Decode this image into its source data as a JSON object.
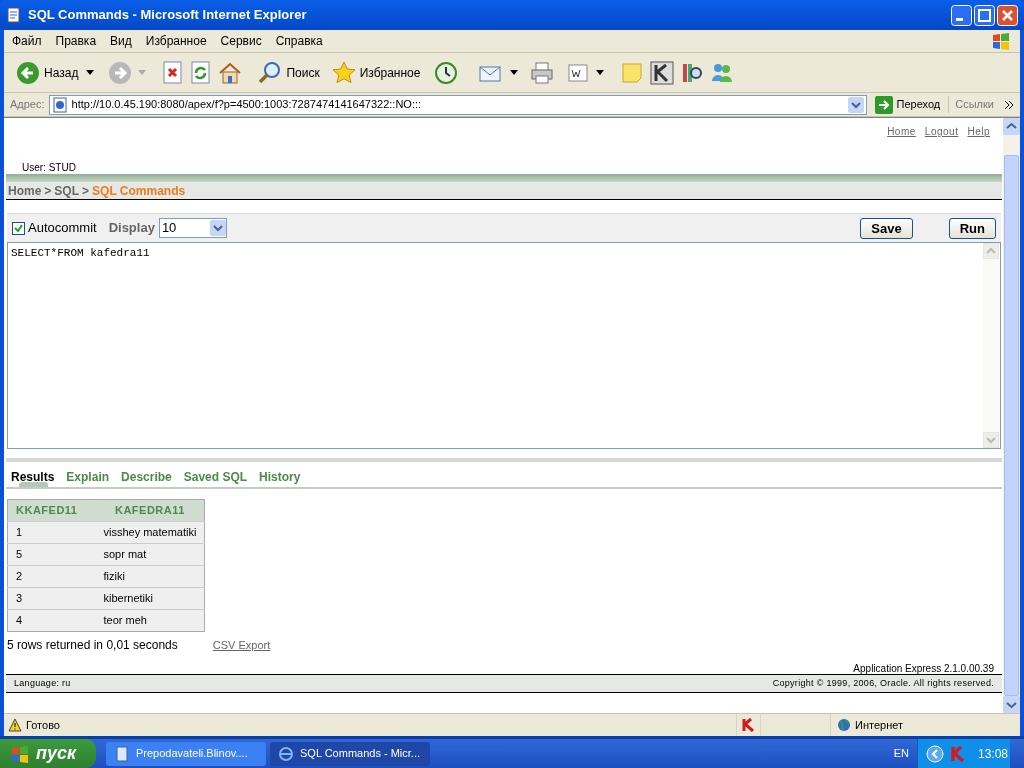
{
  "window": {
    "title": "SQL Commands - Microsoft Internet Explorer"
  },
  "menu": [
    "Файл",
    "Правка",
    "Вид",
    "Избранное",
    "Сервис",
    "Справка"
  ],
  "toolbar": {
    "back": "Назад",
    "search": "Поиск",
    "favorites": "Избранное"
  },
  "address": {
    "label": "Адрес:",
    "url": "http://10.0.45.190:8080/apex/f?p=4500:1003:7287474141647322::NO:::",
    "go": "Переход",
    "links": "Ссылки"
  },
  "page": {
    "header_links": [
      "Home",
      "Logout",
      "Help"
    ],
    "user": "User: STUD",
    "breadcrumb": [
      {
        "label": "Home",
        "current": false
      },
      {
        "separator": ">",
        "label": "SQL",
        "current": false
      },
      {
        "separator": ">",
        "label": "SQL Commands",
        "current": true
      }
    ],
    "autocommit": {
      "label": "Autocommit",
      "checked": true
    },
    "display": {
      "label": "Display",
      "value": "10"
    },
    "buttons": [
      "Save",
      "Run"
    ],
    "sql": "SELECT*FROM kafedra11",
    "tabs": [
      {
        "label": "Results",
        "selected": true
      },
      {
        "label": "Explain",
        "selected": false
      },
      {
        "label": "Describe",
        "selected": false
      },
      {
        "label": "Saved SQL",
        "selected": false
      },
      {
        "label": "History",
        "selected": false
      }
    ],
    "table": {
      "columns": [
        "KKAFED11",
        "KAFEDRA11"
      ],
      "rows": [
        [
          "1",
          "visshey matematiki"
        ],
        [
          "5",
          "sopr mat"
        ],
        [
          "2",
          "fiziki"
        ],
        [
          "3",
          "kibernetiki"
        ],
        [
          "4",
          "teor meh"
        ]
      ]
    },
    "summary": "5 rows returned in 0,01 seconds",
    "csv_export": "CSV Export",
    "version": "Application Express 2.1.0.00.39",
    "language": "Language: ru",
    "copyright": "Copyright © 1999, 2006, Oracle. All rights reserved."
  },
  "status_bar": {
    "text": "Готово",
    "zone": "Интернет"
  },
  "taskbar": {
    "start": "пуск",
    "tasks": [
      {
        "label": "Prepodavateli.Blinov....",
        "selected": false
      },
      {
        "label": "SQL Commands - Micr...",
        "selected": true
      }
    ],
    "lang": "EN",
    "clock": "13:08"
  }
}
